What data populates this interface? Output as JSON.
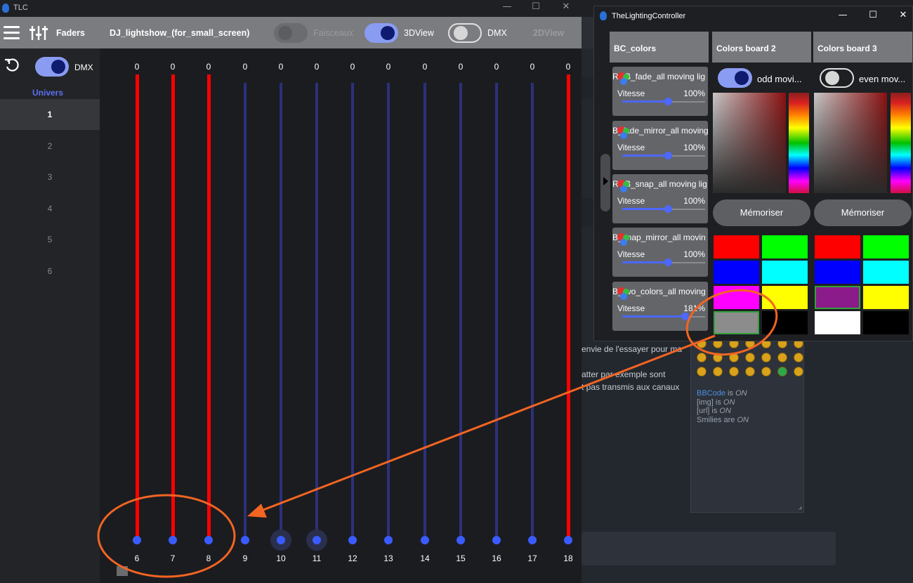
{
  "main_window": {
    "title": "TLC",
    "controls": [
      "—",
      "☐",
      "✕"
    ],
    "toolbar": {
      "section": "Faders",
      "show_name": "DJ_lightshow_(for_small_screen)",
      "faisceaux_label": "Faisceaux",
      "view3d_label": "3DView",
      "dmx_label": "DMX",
      "view2d_label": "2DView"
    },
    "sidebar": {
      "dmx_label": "DMX",
      "univers_label": "Univers",
      "universes": [
        "1",
        "2",
        "3",
        "4",
        "5",
        "6"
      ],
      "selected": "1"
    },
    "faders": [
      {
        "channel": "6",
        "value": "0",
        "active": true
      },
      {
        "channel": "7",
        "value": "0",
        "active": true
      },
      {
        "channel": "8",
        "value": "0",
        "active": true
      },
      {
        "channel": "9",
        "value": "0",
        "active": false
      },
      {
        "channel": "10",
        "value": "0",
        "active": false
      },
      {
        "channel": "11",
        "value": "0",
        "active": false
      },
      {
        "channel": "12",
        "value": "0",
        "active": false
      },
      {
        "channel": "13",
        "value": "0",
        "active": false
      },
      {
        "channel": "14",
        "value": "0",
        "active": false
      },
      {
        "channel": "15",
        "value": "0",
        "active": false
      },
      {
        "channel": "16",
        "value": "0",
        "active": false
      },
      {
        "channel": "17",
        "value": "0",
        "active": false
      },
      {
        "channel": "18",
        "value": "0",
        "active": true
      }
    ]
  },
  "lighting_window": {
    "title": "TheLightingController",
    "controls": [
      "—",
      "☐",
      "✕"
    ],
    "columns": [
      "BC_colors",
      "Colors board 2",
      "Colors board 3"
    ],
    "effects": [
      {
        "name": "RGB_fade_all moving lig",
        "speed_label": "Vitesse",
        "speed": "100%",
        "speed_fraction": 0.55
      },
      {
        "name": "B_fade_mirror_all moving",
        "speed_label": "Vitesse",
        "speed": "100%",
        "speed_fraction": 0.55
      },
      {
        "name": "RGB_snap_all moving lig",
        "speed_label": "Vitesse",
        "speed": "100%",
        "speed_fraction": 0.55
      },
      {
        "name": "B_snap_mirror_all movin",
        "speed_label": "Vitesse",
        "speed": "100%",
        "speed_fraction": 0.55
      },
      {
        "name": "B_two_colors_all moving",
        "speed_label": "Vitesse",
        "speed": "181%",
        "speed_fraction": 0.75
      }
    ],
    "board2": {
      "toggle_label": "odd movi...",
      "toggle_on": true,
      "memo_label": "Mémoriser",
      "swatches": [
        "#ff0000",
        "#00ff00",
        "#0000ff",
        "#00ffff",
        "#ff00ff",
        "#ffff00",
        "#8c8c8c",
        "#000000"
      ],
      "selected_index": 6
    },
    "board3": {
      "toggle_label": "even mov...",
      "toggle_on": false,
      "memo_label": "Mémoriser",
      "swatches": [
        "#ff0000",
        "#00ff00",
        "#0000ff",
        "#00ffff",
        "#8b1a8b",
        "#ffff00",
        "#ffffff",
        "#000000"
      ],
      "selected_index": 4
    }
  },
  "forum": {
    "text_lines": [
      "envie de l'essayer pour ma",
      "",
      "atter par exemple sont",
      "t pas transmis aux canaux"
    ],
    "bbcode": {
      "bbcode_link": "BBCode",
      "bbcode_state": "ON",
      "img_code": "[img]",
      "img_state": "ON",
      "url_code": "[url]",
      "url_state": "ON",
      "smilies_label": "Smilies are",
      "smilies_state": "ON",
      "is_word": "is",
      "resize_glyph": "⌟"
    }
  },
  "colors": {
    "accent": "#4c68ff",
    "active_fader": "#ff0000",
    "annotation": "#f26522"
  }
}
